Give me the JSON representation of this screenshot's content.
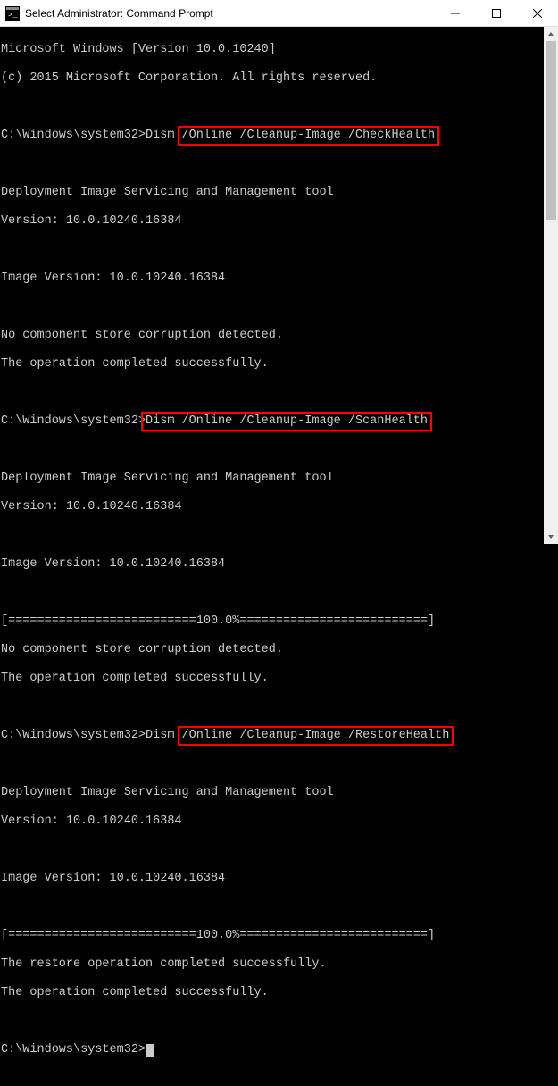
{
  "window": {
    "title": "Select Administrator: Command Prompt"
  },
  "term": {
    "l1": "Microsoft Windows [Version 10.0.10240]",
    "l2": "(c) 2015 Microsoft Corporation. All rights reserved.",
    "prompt1_pre": "C:\\Windows\\system32>Dism ",
    "cmd1": "/Online /Cleanup-Image /CheckHealth",
    "tool": "Deployment Image Servicing and Management tool",
    "ver": "Version: 10.0.10240.16384",
    "imgver": "Image Version: 10.0.10240.16384",
    "nocorrupt": "No component store corruption detected.",
    "success": "The operation completed successfully.",
    "prompt2_pre": "C:\\Windows\\system32>",
    "cmd2": "Dism /Online /Cleanup-Image /ScanHealth",
    "progress": "[==========================100.0%==========================]",
    "prompt3_pre": "C:\\Windows\\system32>Dism ",
    "cmd3": "/Online /Cleanup-Image /RestoreHealth",
    "restore_success": "The restore operation completed successfully.",
    "final_prompt": "C:\\Windows\\system32>"
  }
}
